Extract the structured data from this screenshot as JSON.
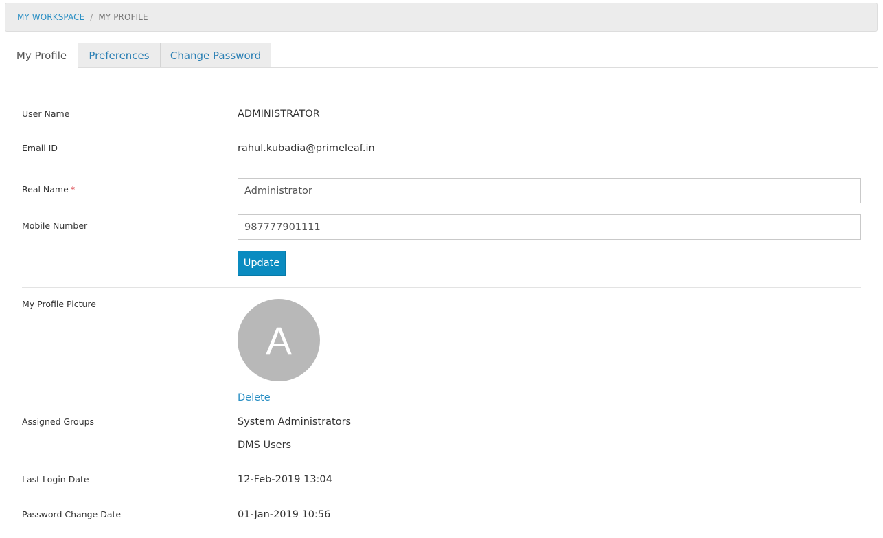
{
  "breadcrumb": {
    "root": "MY WORKSPACE",
    "separator": "/",
    "current": "MY PROFILE"
  },
  "tabs": [
    {
      "label": "My Profile",
      "active": true
    },
    {
      "label": "Preferences",
      "active": false
    },
    {
      "label": "Change Password",
      "active": false
    }
  ],
  "profile": {
    "username_label": "User Name",
    "username": "ADMINISTRATOR",
    "email_label": "Email ID",
    "email": "rahul.kubadia@primeleaf.in",
    "realname_label": "Real Name",
    "required_marker": "*",
    "realname_value": "Administrator",
    "mobile_label": "Mobile Number",
    "mobile_value": "987777901111",
    "update_label": "Update",
    "picture_label": "My Profile Picture",
    "avatar_initial": "A",
    "delete_label": "Delete",
    "groups_label": "Assigned Groups",
    "groups": [
      "System Administrators",
      "DMS Users"
    ],
    "last_login_label": "Last Login Date",
    "last_login": "12-Feb-2019 13:04",
    "pwd_change_label": "Password Change Date",
    "pwd_change": "01-Jan-2019 10:56"
  },
  "colors": {
    "accent": "#0a8bc0",
    "link": "#2a8fc4",
    "required": "#d9363e"
  }
}
